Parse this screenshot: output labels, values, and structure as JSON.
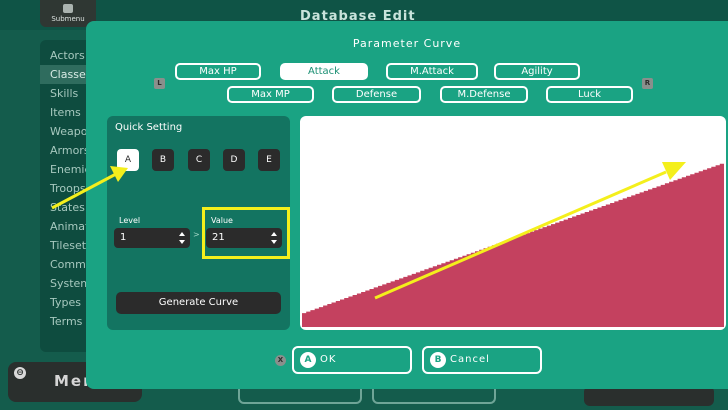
{
  "background": {
    "title": "Database Edit",
    "submenu_label": "Submenu",
    "menu_label": "Menu",
    "menu_key": "⊖",
    "sidebar_items": [
      "Actors",
      "Classes",
      "Skills",
      "Items",
      "Weapons",
      "Armors",
      "Enemies",
      "Troops",
      "States",
      "Animations",
      "Tilesets",
      "Common Events",
      "System",
      "Types",
      "Terms"
    ],
    "sidebar_active": 1
  },
  "dialog": {
    "title": "Parameter Curve",
    "prev_key": "L",
    "next_key": "R",
    "tabs": [
      {
        "label": "Max HP",
        "active": false
      },
      {
        "label": "Attack",
        "active": true
      },
      {
        "label": "M.Attack",
        "active": false
      },
      {
        "label": "Agility",
        "active": false
      },
      {
        "label": "Max MP",
        "active": false
      },
      {
        "label": "Defense",
        "active": false
      },
      {
        "label": "M.Defense",
        "active": false
      },
      {
        "label": "Luck",
        "active": false
      }
    ],
    "quick_setting": {
      "title": "Quick Setting",
      "presets": [
        "A",
        "B",
        "C",
        "D",
        "E"
      ],
      "selected_preset": "A",
      "level_label": "Level",
      "level_value": "1",
      "value_label": "Value",
      "value_value": "21",
      "arrow_glyph": ">",
      "generate_label": "Generate Curve"
    },
    "curve": {
      "type": "area",
      "color": "#c4415f",
      "start_fraction": 0.065,
      "end_fraction": 0.77
    },
    "buttons": {
      "close_key": "X",
      "ok_key": "A",
      "ok_label": "OK",
      "cancel_key": "B",
      "cancel_label": "Cancel"
    }
  },
  "annotations": {
    "arrow_color": "#f4ef1c"
  }
}
